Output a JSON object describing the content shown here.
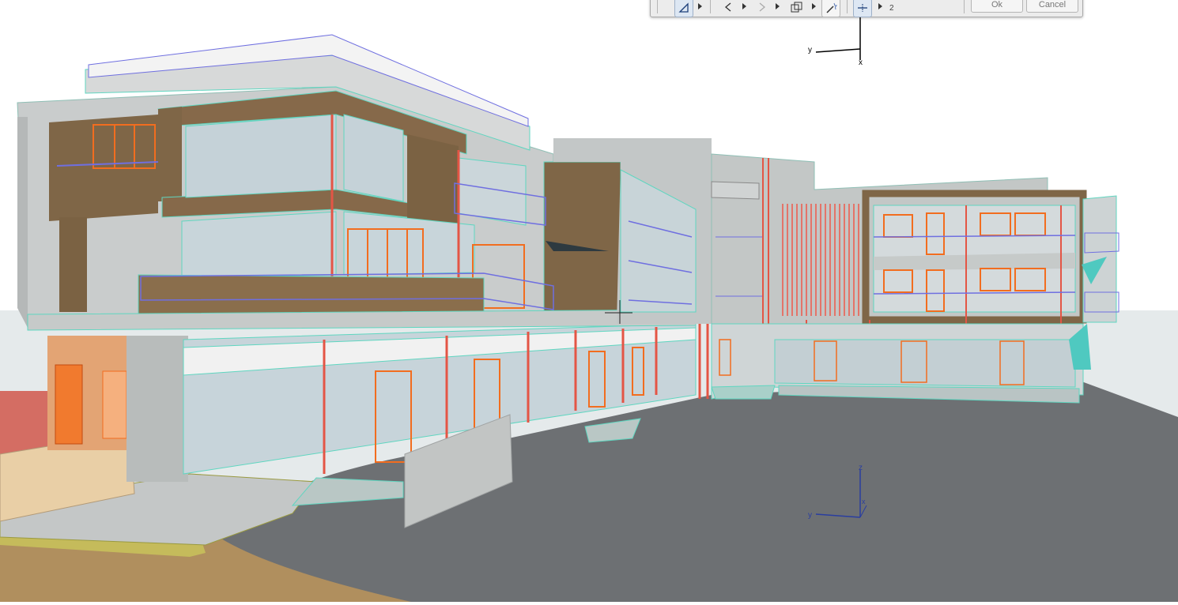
{
  "toolbar": {
    "buttons": [
      {
        "name": "pet-palette-icon",
        "active": true
      },
      {
        "name": "rotate-icon",
        "active": false
      },
      {
        "name": "mirror-icon",
        "active": false
      },
      {
        "name": "multiply-icon",
        "active": false
      },
      {
        "name": "magic-wand-icon",
        "active": false
      },
      {
        "name": "distribute-icon",
        "active": true
      }
    ],
    "value": "2",
    "ok_label": "Ok",
    "cancel_label": "Cancel"
  },
  "axes": {
    "top": {
      "x": "x",
      "y": "y"
    },
    "bottom": {
      "x": "x",
      "y": "y",
      "z": "z"
    }
  },
  "colors": {
    "sky": "#ffffff",
    "ground": "#e8edee",
    "road": "#6d7073",
    "concrete": "#c9cccc",
    "glass": "#b9c9d1",
    "wood": "#7f6647",
    "orange_frame": "#f26d1f",
    "red_column": "#e45545",
    "railing": "#6f6fe0",
    "outline": "#5fd6c0",
    "soil": "#b08f5e",
    "wall_red": "#d46d63"
  }
}
